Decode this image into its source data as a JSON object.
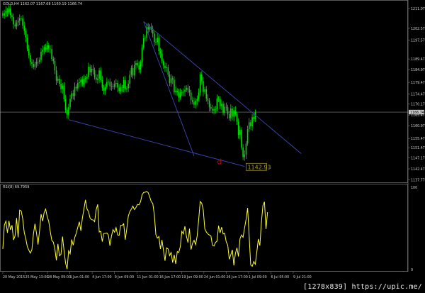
{
  "window": {
    "symbol_label": "GOLD,H4",
    "ohlc": "1162.07 1167.68 1160.19 1166.74",
    "indicator_label": "RSI(8) 69.7959",
    "watermark": "[1278x839] https://upic.me/"
  },
  "colors": {
    "background": "#000000",
    "frame": "#6f6f6f",
    "bull_candle": "#00e000",
    "rsi_line": "#ffff33",
    "trendline": "#3c48b4",
    "price_line": "#8a8a8a",
    "label_text": "#d2d2d2",
    "marker_text": "#d00000",
    "target_label": "#b0a030"
  },
  "chart_data": [
    {
      "type": "candlestick",
      "title": "GOLD,H4",
      "y_axis_ticks": [
        "1211.07",
        "1202.57",
        "1197.57",
        "1189.47",
        "1184.97",
        "1179.47",
        "1174.47",
        "1170.17",
        "1165.47",
        "1160.97",
        "1155.47",
        "1151.47",
        "1147.17",
        "1142.47",
        "1137.77"
      ],
      "y_axis_values": [
        1211.07,
        1202.57,
        1197.57,
        1189.47,
        1184.97,
        1179.47,
        1174.47,
        1170.17,
        1165.47,
        1160.97,
        1155.47,
        1151.47,
        1147.17,
        1142.47,
        1137.77
      ],
      "ylim": [
        1136.5,
        1213.5
      ],
      "current_price": 1166.74,
      "current_price_label": "1166.74",
      "x_axis_ticks": [
        "20 May 2015",
        "25 May 13:00",
        "28 May 09:00",
        "1 Jun 01:00",
        "4 Jun 17:00",
        "9 Jun 09:00",
        "11 Jun 01:00",
        "16 Jun 17:00",
        "19 Jun 09:00",
        "24 Jun 01:00",
        "26 Jun 17:00",
        "1 Jul 09:00",
        "6 Jul 05:00",
        "9 Jul 21:00"
      ],
      "closes": [
        1208.0,
        1209.0,
        1210.2,
        1209.6,
        1211.0,
        1208.2,
        1207.4,
        1204.3,
        1203.4,
        1205.1,
        1205.9,
        1206.8,
        1206.8,
        1203.7,
        1201.5,
        1198.6,
        1193.8,
        1191.0,
        1188.2,
        1187.4,
        1186.1,
        1187.3,
        1188.3,
        1188.3,
        1189.1,
        1192.6,
        1193.4,
        1194.5,
        1193.6,
        1195.3,
        1193.9,
        1193.7,
        1189.5,
        1188.6,
        1184.6,
        1180.2,
        1181.0,
        1178.9,
        1176.6,
        1178.1,
        1172.3,
        1167.7,
        1165.6,
        1168.8,
        1172.4,
        1174.8,
        1173.7,
        1177.6,
        1176.9,
        1179.2,
        1179.5,
        1180.7,
        1178.6,
        1180.9,
        1181.2,
        1181.7,
        1186.1,
        1183.8,
        1185.3,
        1184.7,
        1181.6,
        1180.5,
        1181.1,
        1184.6,
        1180.4,
        1177.2,
        1175.9,
        1177.4,
        1179.7,
        1179.7,
        1177.8,
        1178.0,
        1177.6,
        1178.8,
        1179.2,
        1177.2,
        1175.7,
        1177.3,
        1177.1,
        1180.4,
        1176.5,
        1176.9,
        1178.9,
        1182.7,
        1185.6,
        1182.4,
        1186.8,
        1187.7,
        1186.7,
        1184.9,
        1188.0,
        1194.3,
        1198.3,
        1198.5,
        1203.1,
        1202.1,
        1203.3,
        1202.0,
        1200.3,
        1196.8,
        1196.6,
        1198.5,
        1192.8,
        1191.8,
        1188.6,
        1186.6,
        1185.6,
        1186.0,
        1182.8,
        1179.2,
        1181.2,
        1180.6,
        1175.2,
        1175.9,
        1175.3,
        1173.0,
        1175.1,
        1175.2,
        1175.4,
        1176.3,
        1177.1,
        1176.2,
        1175.2,
        1171.9,
        1171.1,
        1169.9,
        1171.6,
        1172.4,
        1175.1,
        1182.8,
        1180.0,
        1175.4,
        1176.5,
        1172.6,
        1171.7,
        1168.9,
        1168.1,
        1167.4,
        1168.0,
        1168.0,
        1172.5,
        1172.3,
        1169.5,
        1170.3,
        1166.4,
        1169.0,
        1168.8,
        1165.9,
        1164.1,
        1168.3,
        1164.8,
        1167.5,
        1165.9,
        1162.6,
        1157.0,
        1159.2,
        1151.6,
        1147.5,
        1148.6,
        1153.3,
        1159.5,
        1162.4,
        1160.7,
        1164.6,
        1163.8,
        1166.7
      ],
      "trendlines": [
        {
          "from": {
            "bar": 43,
            "price": 1163.5
          },
          "to": {
            "bar": 158,
            "price": 1143.5
          }
        },
        {
          "from": {
            "bar": 92,
            "price": 1205.5
          },
          "to": {
            "bar": 195,
            "price": 1149.0
          }
        },
        {
          "from": {
            "bar": 92,
            "price": 1205.5
          },
          "to": {
            "bar": 125,
            "price": 1148.0
          }
        }
      ],
      "annotations": [
        {
          "text": "d",
          "bar": 140,
          "price": 1144.5,
          "kind": "marker"
        },
        {
          "text": "1142.93",
          "bar": 159,
          "price": 1143.3,
          "kind": "target-label"
        }
      ]
    },
    {
      "type": "line",
      "title": "RSI(8) 69.7959",
      "ylabel": "RSI(8)",
      "ylim": [
        0,
        100
      ],
      "y_axis_ticks": [
        "100",
        "0"
      ],
      "levels": [
        30,
        70
      ],
      "values": [
        25.1,
        54.2,
        58.9,
        44.7,
        59.2,
        48.2,
        53.9,
        36.0,
        41.0,
        62.7,
        39.2,
        72.3,
        71.3,
        61.7,
        45.1,
        37.5,
        27.9,
        23.6,
        20.0,
        24.3,
        43.3,
        55.7,
        44.4,
        30.4,
        47.3,
        67.4,
        58.8,
        69.4,
        73.5,
        64.3,
        58.6,
        46.4,
        35.5,
        33.5,
        25.3,
        11.2,
        31.3,
        16.7,
        18.5,
        40.2,
        23.1,
        7.9,
        0.7,
        22.9,
        19.2,
        36.5,
        29.6,
        39.0,
        44.2,
        51.5,
        58.1,
        47.1,
        62.8,
        73.4,
        84.7,
        73.7,
        70.4,
        62.7,
        60.6,
        60.3,
        58.2,
        72.8,
        79.2,
        45.7,
        46.4,
        34.0,
        43.9,
        44.0,
        44.5,
        41.8,
        28.9,
        40.6,
        48.6,
        45.4,
        51.0,
        42.2,
        41.5,
        53.7,
        53.7,
        55.7,
        36.4,
        49.3,
        65.0,
        70.5,
        73.6,
        77.1,
        72.8,
        75.4,
        79.1,
        78.7,
        82.5,
        90.9,
        93.7,
        94.0,
        95.0,
        93.5,
        88.3,
        82.5,
        80.4,
        67.1,
        42.8,
        38.3,
        40.2,
        25.1,
        36.0,
        23.4,
        10.7,
        26.4,
        25.2,
        16.9,
        20.8,
        8.5,
        17.9,
        6.9,
        21.8,
        20.8,
        27.9,
        46.5,
        43.3,
        52.6,
        40.5,
        32.9,
        49.7,
        24.4,
        32.1,
        35.6,
        30.3,
        40.8,
        60.5,
        82.8,
        80.6,
        72.6,
        49.6,
        45.7,
        43.3,
        42.1,
        40.9,
        29.6,
        28.6,
        32.9,
        34.7,
        53.2,
        44.6,
        51.5,
        43.3,
        44.0,
        33.8,
        29.7,
        12.5,
        18.1,
        24.0,
        5.1,
        19.4,
        26.5,
        15.9,
        37.4,
        42.1,
        39.2,
        50.7,
        61.1,
        74.9,
        40.7,
        5.8,
        3.9,
        9.8,
        6.4,
        21.4,
        37.2,
        29.1,
        57.4,
        77.9,
        82.4,
        49.2,
        69.8
      ]
    }
  ]
}
